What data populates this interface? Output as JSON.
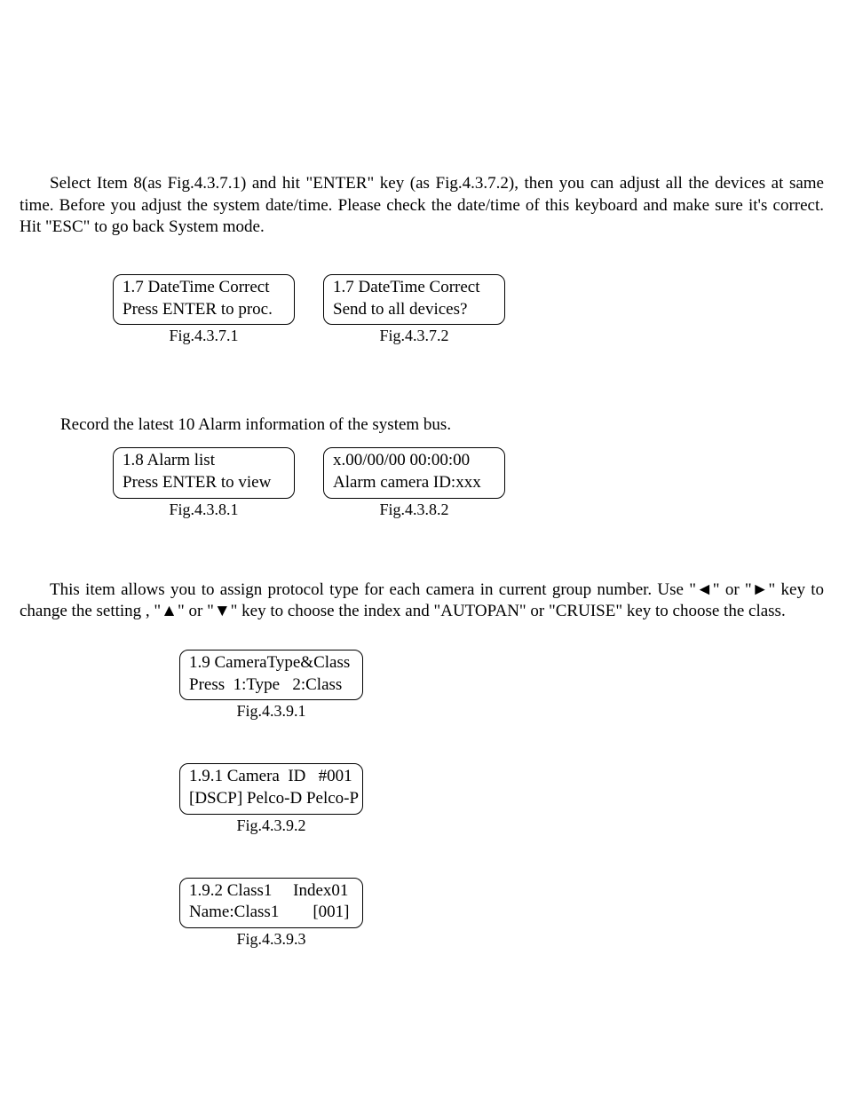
{
  "section1": {
    "para": "Select Item 8(as Fig.4.3.7.1) and hit \"ENTER\" key (as Fig.4.3.7.2), then you can adjust all the devices at same time. Before you adjust the system date/time. Please check the date/time of this keyboard and make sure it's correct. Hit \"ESC\" to go back System mode.",
    "lcd1": {
      "line1": "1.7 DateTime Correct",
      "line2": "Press ENTER to proc.",
      "caption": "Fig.4.3.7.1"
    },
    "lcd2": {
      "line1": "1.7 DateTime Correct",
      "line2": "Send to all devices?",
      "caption": "Fig.4.3.7.2"
    }
  },
  "section2": {
    "para": "Record the latest 10 Alarm information of the system bus.",
    "lcd1": {
      "line1": "1.8 Alarm list",
      "line2": "Press ENTER to view",
      "caption": "Fig.4.3.8.1"
    },
    "lcd2": {
      "line1": "x.00/00/00 00:00:00",
      "line2": "Alarm camera ID:xxx",
      "caption": "Fig.4.3.8.2"
    }
  },
  "section3": {
    "para": "This item allows you to assign protocol type for each camera in current group number. Use \"◄\" or \"►\" key to change the setting , \"▲\" or \"▼\" key to choose the index and \"AUTOPAN\" or \"CRUISE\" key to choose the class.",
    "lcd1": {
      "line1": "1.9 CameraType&Class",
      "line2": "Press  1:Type   2:Class",
      "caption": "Fig.4.3.9.1"
    },
    "lcd2": {
      "line1": "1.9.1 Camera  ID   #001",
      "line2": "[DSCP] Pelco-D Pelco-P",
      "caption": "Fig.4.3.9.2"
    },
    "lcd3": {
      "line1": "1.9.2 Class1     Index01",
      "line2": "Name:Class1        [001]",
      "caption": "Fig.4.3.9.3"
    }
  }
}
